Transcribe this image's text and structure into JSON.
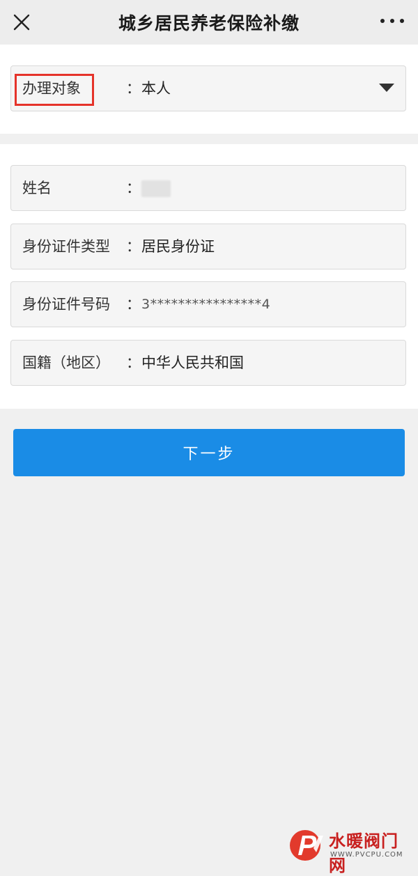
{
  "header": {
    "title": "城乡居民养老保险补缴",
    "close_icon": "close-icon",
    "more_icon": "more-icon"
  },
  "applicant": {
    "label": "办理对象",
    "colon": "：",
    "value": "本人",
    "dropdown_icon": "caret-down-icon",
    "highlight_color": "#e5332a"
  },
  "form": {
    "fields": [
      {
        "label": "姓名",
        "colon": "：",
        "value": ""
      },
      {
        "label": "身份证件类型",
        "colon": "：",
        "value": "居民身份证"
      },
      {
        "label": "身份证件号码",
        "colon": "：",
        "value": "3****************4"
      },
      {
        "label": "国籍（地区）",
        "colon": "：",
        "value": "中华人民共和国"
      }
    ]
  },
  "actions": {
    "next_label": "下一步",
    "accent_color": "#1a8ce6"
  },
  "watermark": {
    "text": "水暖阀门网",
    "sub": "WWW.PVCPU.COM"
  }
}
